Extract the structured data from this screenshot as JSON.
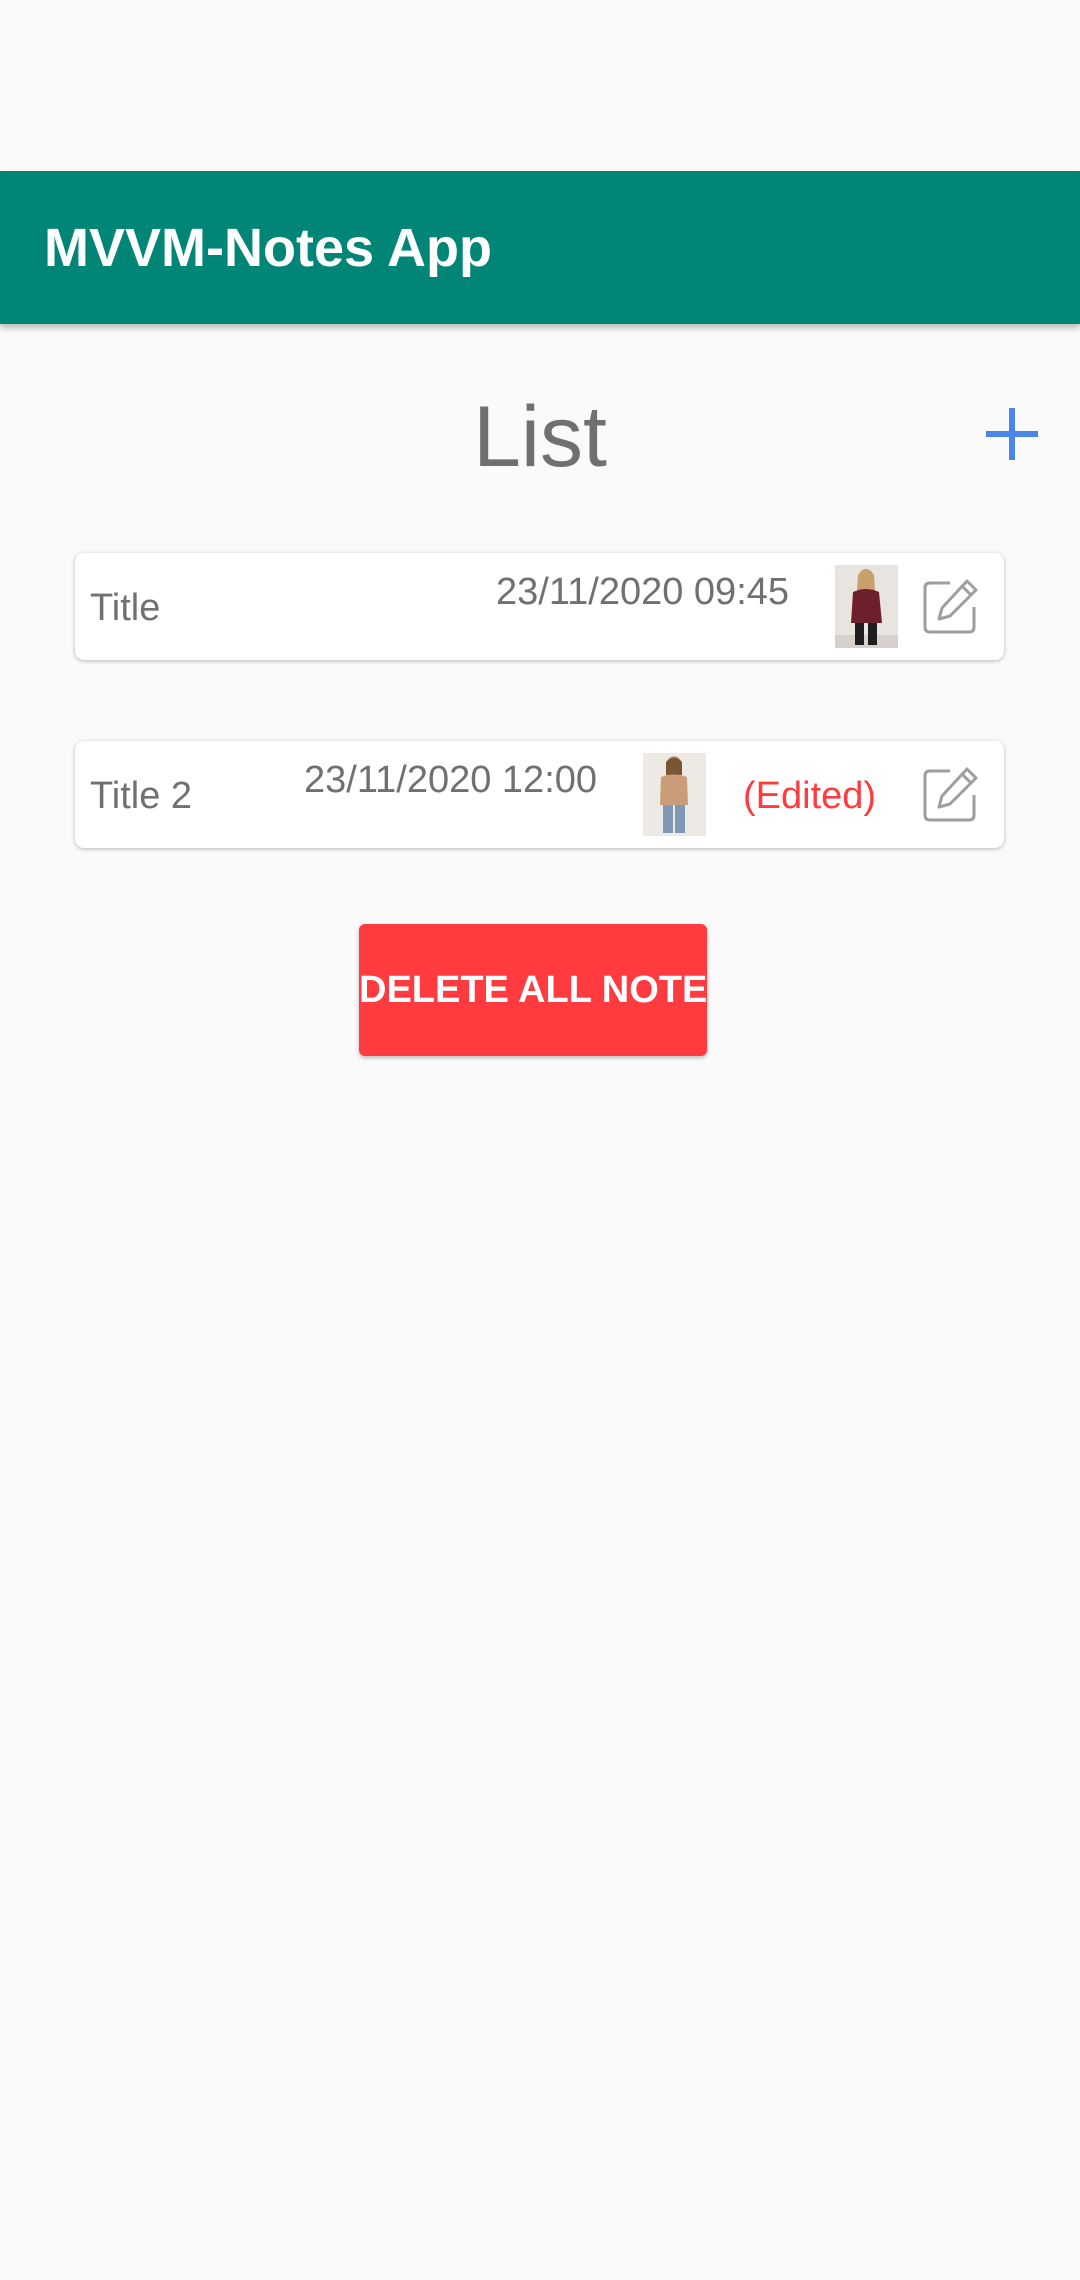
{
  "app_bar": {
    "title": "MVVM-Notes App",
    "color": "#008577"
  },
  "screen": {
    "title": "List",
    "add_icon": "plus-icon",
    "accent_color": "#4a86e8"
  },
  "notes": [
    {
      "title": "Title",
      "date": "23/11/2020 09:45",
      "image": "photo-woman-burgundy-sweater",
      "edited": "",
      "edit_icon": "pencil-square-icon"
    },
    {
      "title": "Title 2",
      "date": "23/11/2020 12:00",
      "image": "photo-woman-beige-sweater",
      "edited": "(Edited)",
      "edit_icon": "pencil-square-icon"
    }
  ],
  "delete_button": {
    "label": "DELETE ALL NOTES",
    "color": "#ff3b3f"
  }
}
